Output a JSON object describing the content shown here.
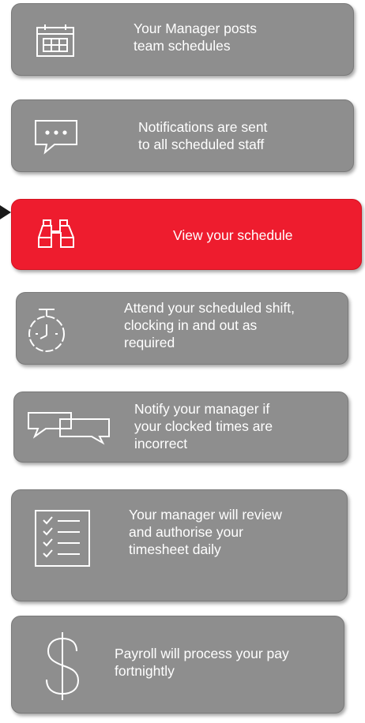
{
  "steps": [
    {
      "label": "Your Manager posts\nteam schedules",
      "icon": "calendar-icon"
    },
    {
      "label": "Notifications are sent\nto all scheduled staff",
      "icon": "chat-bubble-icon"
    },
    {
      "label": "View your schedule",
      "icon": "binoculars-icon",
      "highlighted": true
    },
    {
      "label": "Attend your scheduled shift,\nclocking in and out as\nrequired",
      "icon": "stopwatch-icon"
    },
    {
      "label": "Notify your manager if\nyour clocked times are\nincorrect",
      "icon": "conversation-icon"
    },
    {
      "label": "Your manager will review\nand authorise your\ntimesheet daily",
      "icon": "checklist-icon"
    },
    {
      "label": "Payroll will process your pay\nfortnightly",
      "icon": "dollar-icon"
    }
  ],
  "colors": {
    "box": "#8e8e8e",
    "highlight": "#ee1c2e",
    "text": "#ffffff",
    "pointer": "#1a1a1a"
  }
}
